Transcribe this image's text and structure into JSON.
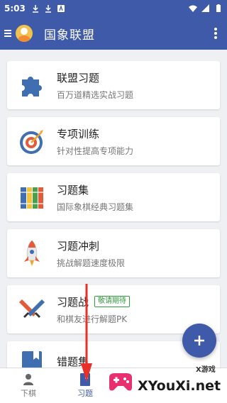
{
  "status_bar": {
    "time": "5:03"
  },
  "app_bar": {
    "title": "国象联盟"
  },
  "cards": [
    {
      "title": "联盟习题",
      "subtitle": "百万道精选实战习题",
      "icon": "puzzle-icon"
    },
    {
      "title": "专项训练",
      "subtitle": "针对性提高专项能力",
      "icon": "target-icon"
    },
    {
      "title": "习题集",
      "subtitle": "国际象棋经典习题集",
      "icon": "books-icon"
    },
    {
      "title": "习题冲刺",
      "subtitle": "挑战解题速度极限",
      "icon": "rocket-icon"
    },
    {
      "title": "习题战",
      "badge": "敬请期待",
      "subtitle": "和棋友进行解题PK",
      "icon": "swords-icon"
    },
    {
      "title": "错题集",
      "subtitle": "",
      "icon": "bookmark-icon"
    }
  ],
  "bottom_nav": {
    "items": [
      {
        "label": "下棋",
        "icon": "person-icon"
      },
      {
        "label": "习题",
        "icon": "book-icon"
      }
    ],
    "active": "习题"
  },
  "watermark": {
    "small": "X游戏",
    "big": "XYouXi.net"
  },
  "colors": {
    "primary": "#3f5aa8",
    "badge": "#2e9d3a",
    "arrow": "#e8302a"
  }
}
